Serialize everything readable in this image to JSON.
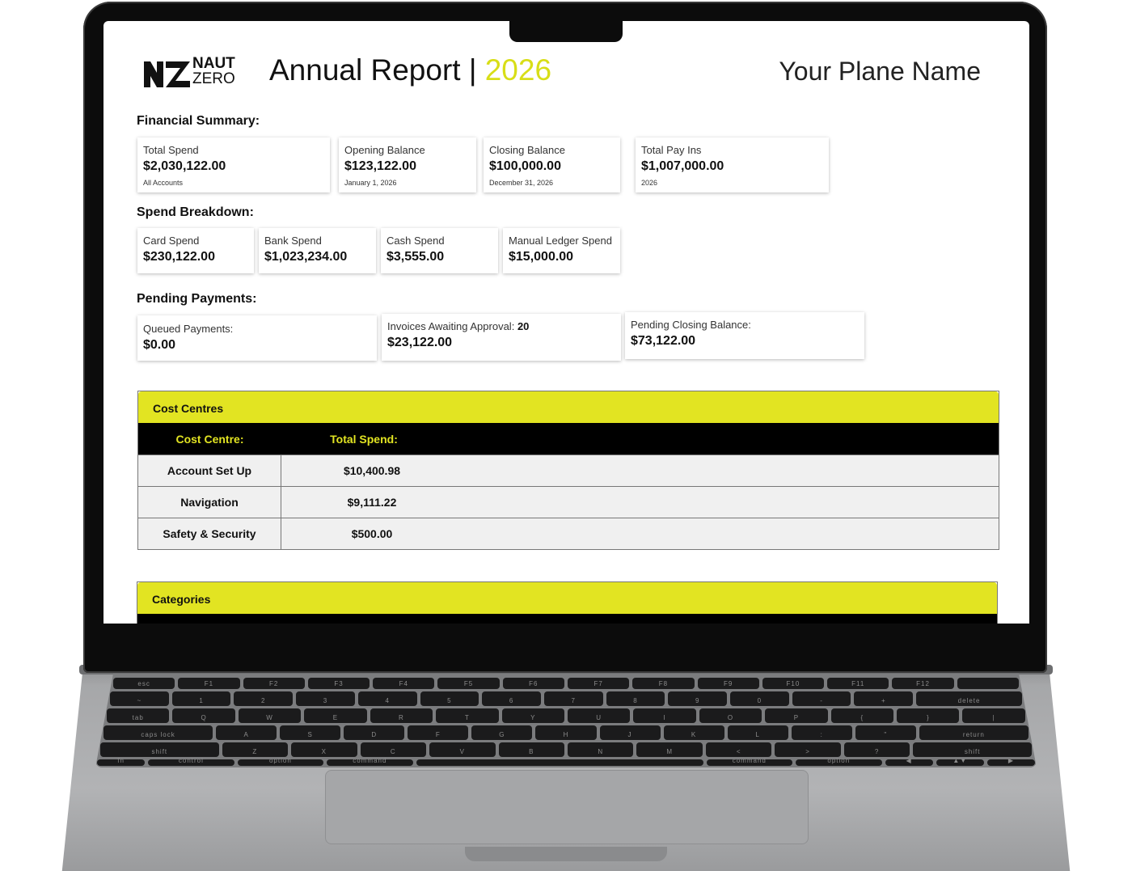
{
  "report": {
    "brand_top": "NAUT",
    "brand_bottom": "ZERO",
    "title_prefix": "Annual Report |",
    "title_year": "2026",
    "plane_name": "Your Plane Name",
    "accent_color": "#e2e422"
  },
  "financial_summary": {
    "heading": "Financial Summary:",
    "cards": [
      {
        "label": "Total Spend",
        "value": "$2,030,122.00",
        "sub": "All Accounts"
      },
      {
        "label": "Opening Balance",
        "value": "$123,122.00",
        "sub": "January 1, 2026"
      },
      {
        "label": "Closing Balance",
        "value": "$100,000.00",
        "sub": "December 31, 2026"
      },
      {
        "label": "Total Pay Ins",
        "value": "$1,007,000.00",
        "sub": "2026"
      }
    ]
  },
  "spend_breakdown": {
    "heading": "Spend Breakdown:",
    "cards": [
      {
        "label": "Card Spend",
        "value": "$230,122.00"
      },
      {
        "label": "Bank Spend",
        "value": "$1,023,234.00"
      },
      {
        "label": "Cash Spend",
        "value": "$3,555.00"
      },
      {
        "label": "Manual Ledger Spend",
        "value": "$15,000.00"
      }
    ]
  },
  "pending_payments": {
    "heading": "Pending Payments:",
    "cards": [
      {
        "label": "Queued Payments:",
        "value": "$0.00"
      },
      {
        "label": "Invoices Awaiting Approval:",
        "count": "20",
        "value": "$23,122.00"
      },
      {
        "label": "Pending Closing Balance:",
        "value": "$73,122.00"
      }
    ]
  },
  "cost_centres": {
    "title": "Cost Centres",
    "col1": "Cost Centre:",
    "col2": "Total Spend:",
    "rows": [
      {
        "name": "Account Set Up",
        "spend": "$10,400.98"
      },
      {
        "name": "Navigation",
        "spend": "$9,111.22"
      },
      {
        "name": "Safety & Security",
        "spend": "$500.00"
      }
    ]
  },
  "categories": {
    "title": "Categories"
  },
  "keyboard": {
    "row1": [
      "esc",
      "F1",
      "F2",
      "F3",
      "F4",
      "F5",
      "F6",
      "F7",
      "F8",
      "F9",
      "F10",
      "F11",
      "F12",
      ""
    ],
    "row2": [
      "~",
      "1",
      "2",
      "3",
      "4",
      "5",
      "6",
      "7",
      "8",
      "9",
      "0",
      "-",
      "+",
      "delete"
    ],
    "row3": [
      "tab",
      "Q",
      "W",
      "E",
      "R",
      "T",
      "Y",
      "U",
      "I",
      "O",
      "P",
      "{",
      "}",
      "|"
    ],
    "row4": [
      "caps lock",
      "A",
      "S",
      "D",
      "F",
      "G",
      "H",
      "J",
      "K",
      "L",
      ":",
      "\"",
      "return"
    ],
    "row5": [
      "shift",
      "Z",
      "X",
      "C",
      "V",
      "B",
      "N",
      "M",
      "<",
      ">",
      "?",
      "shift"
    ],
    "row6": [
      "fn",
      "control",
      "option",
      "command",
      "",
      "command",
      "option",
      "◀",
      "▲▼",
      "▶"
    ]
  }
}
